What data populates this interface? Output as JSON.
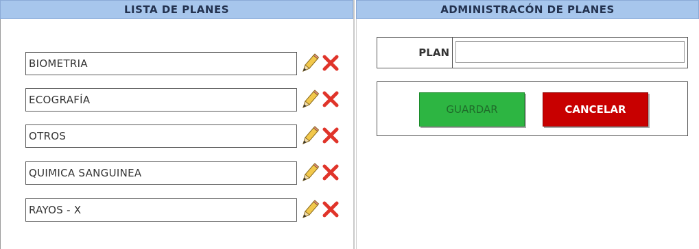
{
  "left_panel": {
    "title": "LISTA DE PLANES",
    "plans": [
      {
        "name": "BIOMETRIA"
      },
      {
        "name": "ECOGRAFÍA"
      },
      {
        "name": "OTROS"
      },
      {
        "name": "QUIMICA SANGUINEA"
      },
      {
        "name": "RAYOS - X"
      }
    ]
  },
  "right_panel": {
    "title": "ADMINISTRACÓN DE PLANES",
    "plan_label": "PLAN",
    "plan_value": "",
    "save_label": "GUARDAR",
    "cancel_label": "CANCELAR"
  },
  "icons": {
    "edit": "pencil-icon",
    "delete": "x-delete-icon"
  },
  "colors": {
    "header_bg": "#a7c6ec",
    "save_bg": "#2db542",
    "cancel_bg": "#c80000",
    "delete_red": "#e0342a"
  }
}
